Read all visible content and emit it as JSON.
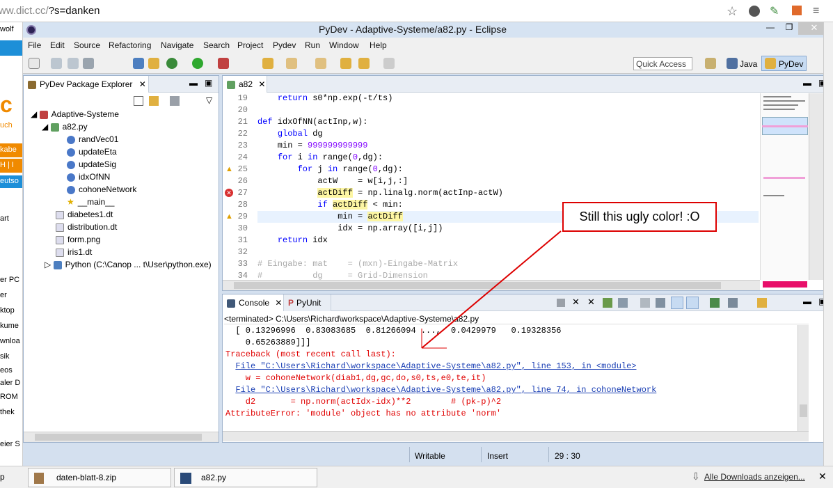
{
  "browser": {
    "url_prefix": "ww.dict.cc/",
    "url_rest": "?s=danken"
  },
  "bg_left": [
    "wolf",
    "c",
    "uch",
    "kabe",
    "H | I",
    "eutso",
    "art",
    "er PC",
    "er",
    "ktop",
    "kume",
    "wnloa",
    "sik",
    "eos",
    "aler D",
    "ROM",
    "thek",
    "eier S"
  ],
  "window": {
    "title": "PyDev - Adaptive-Systeme/a82.py - Eclipse"
  },
  "menu": [
    "File",
    "Edit",
    "Source",
    "Refactoring",
    "Navigate",
    "Search",
    "Project",
    "Pydev",
    "Run",
    "Window",
    "Help"
  ],
  "toolbar": {
    "quick_access": "Quick Access",
    "perspective_java": "Java",
    "perspective_pydev": "PyDev"
  },
  "explorer": {
    "tab": "PyDev Package Explorer",
    "project": "Adaptive-Systeme",
    "file": "a82.py",
    "functions": [
      "randVec01",
      "updateEta",
      "updateSig",
      "idxOfNN",
      "cohoneNetwork",
      "__main__"
    ],
    "files": [
      "diabetes1.dt",
      "distribution.dt",
      "form.png",
      "iris1.dt"
    ],
    "python": "Python  (C:\\Canop ... t\\User\\python.exe)"
  },
  "editor": {
    "tab": "a82",
    "lines": [
      {
        "n": "19",
        "t": "    return s0*np.exp(-t/ts)"
      },
      {
        "n": "20",
        "t": ""
      },
      {
        "n": "21",
        "t": "def idxOfNN(actInp,w):"
      },
      {
        "n": "22",
        "t": "    global dg"
      },
      {
        "n": "23",
        "t": "    min = 999999999999"
      },
      {
        "n": "24",
        "t": "    for i in range(0,dg):"
      },
      {
        "n": "25",
        "t": "        for j in range(0,dg):"
      },
      {
        "n": "26",
        "t": "            actW    = w[i,j,:]"
      },
      {
        "n": "27",
        "t": "            actDiff = np.linalg.norm(actInp-actW)"
      },
      {
        "n": "28",
        "t": "            if actDiff < min:"
      },
      {
        "n": "29",
        "t": "                min = actDiff"
      },
      {
        "n": "30",
        "t": "                idx = np.array([i,j])"
      },
      {
        "n": "31",
        "t": "    return idx"
      },
      {
        "n": "32",
        "t": ""
      },
      {
        "n": "33",
        "t": "# Eingabe: mat    = (mxn)-Eingabe-Matrix"
      },
      {
        "n": "34",
        "t": "#          dg     = Grid-Dimension"
      }
    ]
  },
  "console": {
    "tab": "Console",
    "tab2": "PyUnit",
    "terminated": "<terminated> C:\\Users\\Richard\\workspace\\Adaptive-Systeme\\a82.py",
    "lines": [
      "  [ 0.13296996  0.83083685  0.81266094 ...,  0.0429979   0.19328356",
      "    0.65263889]]]",
      "Traceback (most recent call last):",
      "  File \"C:\\Users\\Richard\\workspace\\Adaptive-Systeme\\a82.py\", line 153, in <module>",
      "    w = cohoneNetwork(diab1,dg,gc,do,s0,ts,e0,te,it)",
      "  File \"C:\\Users\\Richard\\workspace\\Adaptive-Systeme\\a82.py\", line 74, in cohoneNetwork",
      "    d2       = np.norm(actIdx-idx)**2        # (pk-p)^2",
      "AttributeError: 'module' object has no attribute 'norm'"
    ]
  },
  "status": {
    "writable": "Writable",
    "insert": "Insert",
    "position": "29 : 30"
  },
  "annotation": "Still this ugly color! :O",
  "taskbar": {
    "left": "p",
    "item1": "daten-blatt-8.zip",
    "item2": "a82.py",
    "downloads": "Alle Downloads anzeigen..."
  }
}
